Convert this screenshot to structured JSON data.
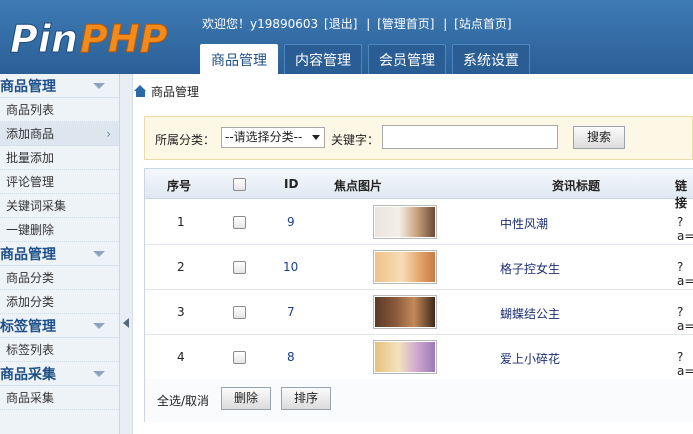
{
  "logo": {
    "text_pin": "Pin",
    "text_php": "PHP"
  },
  "header": {
    "welcome": "欢迎您！y19890603",
    "logout": "[退出]",
    "sep": "|",
    "admin_home": "[管理首页]",
    "site_home": "[站点首页]",
    "tabs": [
      {
        "label": "商品管理",
        "active": true
      },
      {
        "label": "内容管理",
        "active": false
      },
      {
        "label": "会员管理",
        "active": false
      },
      {
        "label": "系统设置",
        "active": false
      }
    ]
  },
  "sidebar": {
    "groups": [
      {
        "title": "商品管理",
        "items": [
          "商品列表",
          "添加商品",
          "批量添加",
          "评论管理",
          "关键词采集",
          "一键删除"
        ]
      },
      {
        "title": "商品管理",
        "items": [
          "商品分类",
          "添加分类"
        ]
      },
      {
        "title": "标签管理",
        "items": [
          "标签列表"
        ]
      },
      {
        "title": "商品采集",
        "items": [
          "商品采集"
        ]
      }
    ],
    "active_item": "添加商品"
  },
  "breadcrumb": {
    "label": "商品管理"
  },
  "search": {
    "category_label": "所属分类：",
    "category_value": "--请选择分类--",
    "keyword_label": "关键字：",
    "keyword_value": "",
    "button": "搜索"
  },
  "table": {
    "headers": {
      "seq": "序号",
      "id": "ID",
      "image": "焦点图片",
      "title": "资讯标题",
      "link": "链接"
    },
    "rows": [
      {
        "seq": "1",
        "id": "9",
        "title": "中性风潮",
        "link": "?a="
      },
      {
        "seq": "2",
        "id": "10",
        "title": "格子控女生",
        "link": "?a="
      },
      {
        "seq": "3",
        "id": "7",
        "title": "蝴蝶结公主",
        "link": "?a="
      },
      {
        "seq": "4",
        "id": "8",
        "title": "爱上小碎花",
        "link": "?a="
      }
    ],
    "footer": {
      "select_all": "全选/取消",
      "delete": "删除",
      "sort": "排序"
    }
  },
  "colors": {
    "header_blue": "#2a5f96",
    "accent_orange": "#f28a1c",
    "link_blue": "#1d3f8f"
  }
}
